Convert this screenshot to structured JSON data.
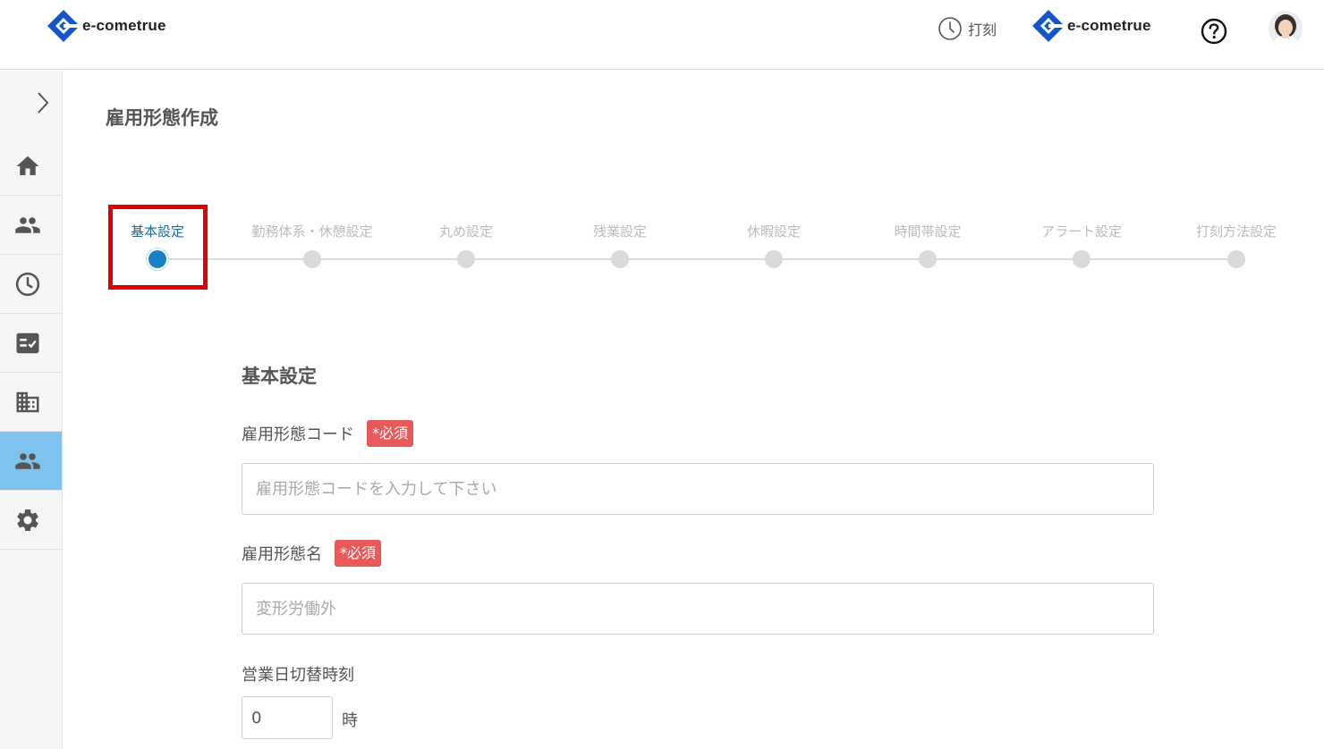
{
  "header": {
    "logo_text": "e-cometrue",
    "clock_label": "打刻",
    "company_logo_text": "e-cometrue",
    "help_icon": "help-circle-icon",
    "avatar_icon": "user-avatar"
  },
  "sidebar": {
    "toggle_icon": "chevron-right-icon",
    "items": [
      {
        "icon": "home-icon",
        "active": false
      },
      {
        "icon": "people-icon",
        "active": false
      },
      {
        "icon": "clock-icon",
        "active": false
      },
      {
        "icon": "checklist-icon",
        "active": false
      },
      {
        "icon": "building-icon",
        "active": false
      },
      {
        "icon": "people-icon",
        "active": true
      },
      {
        "icon": "gear-icon",
        "active": false
      }
    ]
  },
  "page": {
    "title": "雇用形態作成"
  },
  "stepper": {
    "steps": [
      {
        "label": "基本設定",
        "active": true
      },
      {
        "label": "勤務体系・休憩設定",
        "active": false
      },
      {
        "label": "丸め設定",
        "active": false
      },
      {
        "label": "残業設定",
        "active": false
      },
      {
        "label": "休暇設定",
        "active": false
      },
      {
        "label": "時間帯設定",
        "active": false
      },
      {
        "label": "アラート設定",
        "active": false
      },
      {
        "label": "打刻方法設定",
        "active": false
      }
    ]
  },
  "form": {
    "section_title": "基本設定",
    "code": {
      "label": "雇用形態コード",
      "required_badge": "*必須",
      "placeholder": "雇用形態コードを入力して下さい",
      "value": ""
    },
    "name": {
      "label": "雇用形態名",
      "required_badge": "*必須",
      "placeholder": "変形労働外",
      "value": ""
    },
    "switch_time": {
      "label": "営業日切替時刻",
      "value": "0",
      "unit": "時"
    }
  },
  "colors": {
    "accent": "#1a80c8",
    "sidebar_active": "#7ec3ee",
    "required": "#e85a5a",
    "highlight": "#e00000",
    "logo_blue": "#1456c8"
  }
}
